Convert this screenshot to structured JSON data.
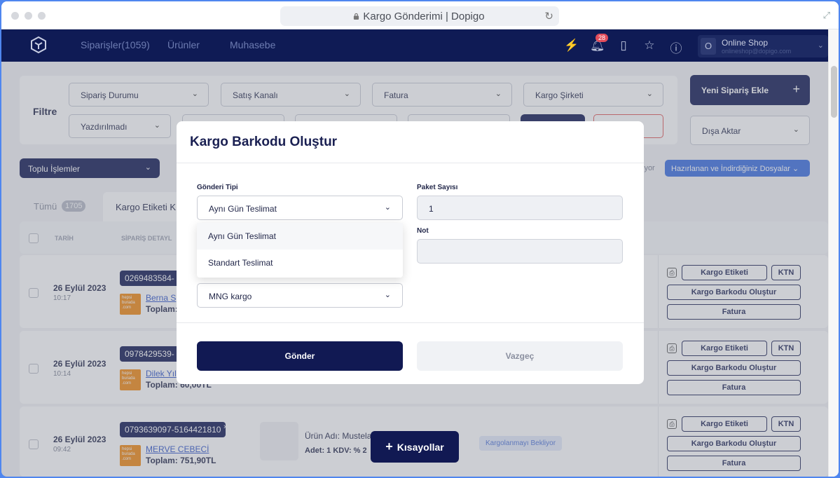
{
  "browser": {
    "url_title": "Kargo Gönderimi | Dopigo"
  },
  "nav": {
    "links": [
      "Siparişler(1059)",
      "Ürünler",
      "Muhasebe"
    ],
    "notification_count": "28",
    "shop_avatar": "O",
    "shop_name": "Online Shop",
    "shop_email": "onlineshop@dopigo.com"
  },
  "filter": {
    "title": "Filtre",
    "selects": [
      "Sipariş Durumu",
      "Satış Kanalı",
      "Fatura",
      "Kargo Şirketi",
      "Yazdırılmadı"
    ],
    "new_order": "Yeni Sipariş Ekle",
    "export": "Dışa Aktar"
  },
  "toolbar": {
    "bulk": "Toplu İşlemler",
    "partial_text": "iyor",
    "files": "Hazırlanan ve İndirdiğiniz Dosyalar",
    "tab_all": "Tümü",
    "tab_all_count": "1705",
    "tab_active": "Kargo Etiketi K"
  },
  "table": {
    "headers": [
      "TARİH",
      "SİPARİŞ DETAYL"
    ],
    "rows": [
      {
        "date": "26 Eylül 2023",
        "time": "10:17",
        "order_id": "0269483584-",
        "customer": "Berna S",
        "total": "Toplam:"
      },
      {
        "date": "26 Eylül 2023",
        "time": "10:14",
        "order_id": "0978429539-",
        "customer": "Dilek Yıl",
        "total": "Toplam: 60,00TL"
      },
      {
        "date": "26 Eylül 2023",
        "time": "09:42",
        "order_id": "0793639097-5164421810",
        "customer": "MERVE CEBECİ",
        "total": "Toplam: 751,90TL",
        "product": "Ürün Adı: Mustela",
        "qty": "Adet: 1   KDV: % 2",
        "status": "Kargolanmayı Bekliyor"
      }
    ],
    "store_logo": "hepsi burada .com",
    "actions": {
      "label": "Kargo Etiketi",
      "ktn": "KTN",
      "barcode": "Kargo Barkodu Oluştur",
      "invoice": "Fatura"
    }
  },
  "modal": {
    "title": "Kargo Barkodu Oluştur",
    "shipment_type_label": "Gönderi Tipi",
    "shipment_type_value": "Aynı Gün Teslimat",
    "package_count_label": "Paket Sayısı",
    "package_count_value": "1",
    "note_label": "Not",
    "note_value": "",
    "options": [
      "Aynı Gün Teslimat",
      "Standart Teslimat"
    ],
    "cargo_value": "MNG kargo",
    "submit": "Gönder",
    "cancel": "Vazgeç"
  },
  "shortcuts": "Kısayollar"
}
